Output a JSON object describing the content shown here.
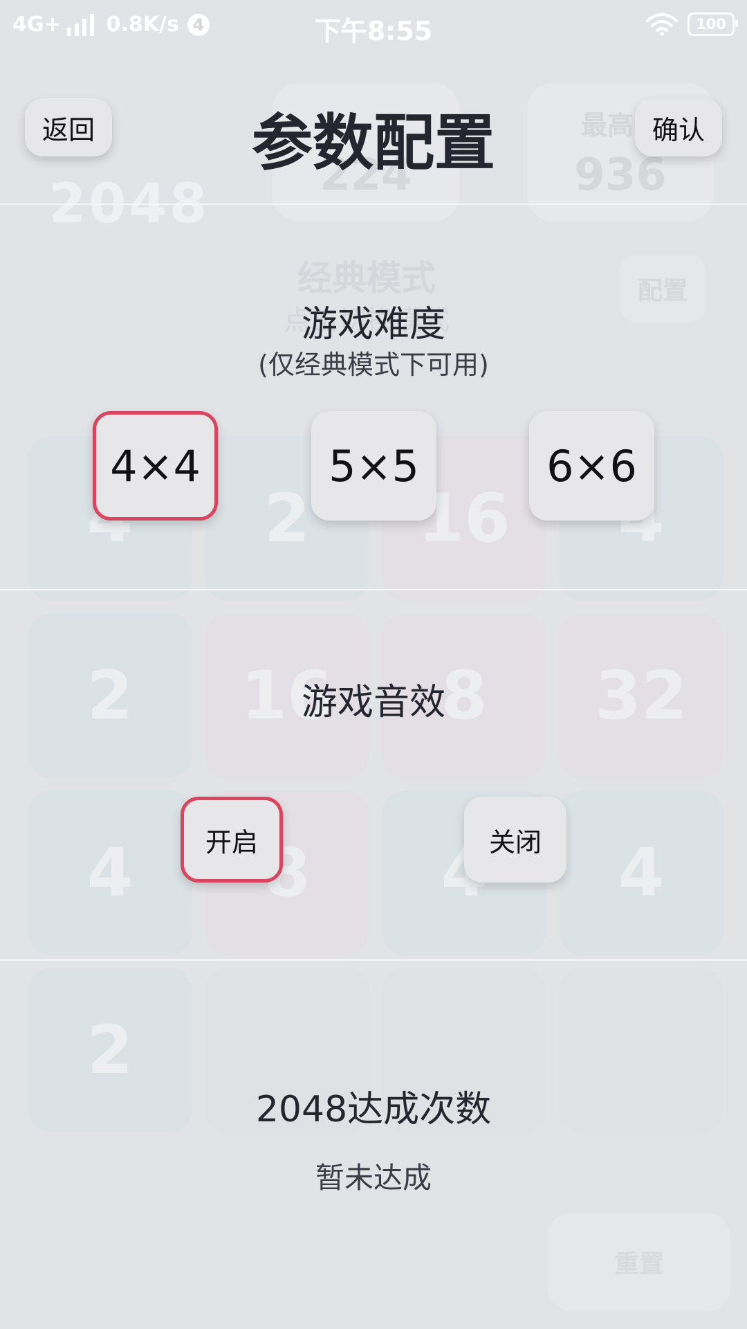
{
  "status_bar": {
    "network": "4G+",
    "speed": "0.8K/s",
    "notification_count": "4",
    "time": "下午8:55",
    "battery": "100"
  },
  "background": {
    "score_label": "",
    "score_value": "224",
    "best_label": "最高分",
    "best_value": "936",
    "logo_text": "2048",
    "mode_title": "经典模式",
    "mode_subtitle": "点击切换模式",
    "config_label": "配置",
    "reset_label": "重置",
    "tiles": [
      "4",
      "2",
      "16",
      "4",
      "2",
      "16",
      "8",
      "32",
      "4",
      "8",
      "4",
      "4",
      "2",
      "",
      "",
      ""
    ]
  },
  "header": {
    "back_label": "返回",
    "title": "参数配置",
    "confirm_label": "确认"
  },
  "difficulty": {
    "title": "游戏难度",
    "subtitle": "(仅经典模式下可用)",
    "options": [
      "4×4",
      "5×5",
      "6×6"
    ],
    "selected": "4×4"
  },
  "sound": {
    "title": "游戏音效",
    "on_label": "开启",
    "off_label": "关闭",
    "selected": "开启"
  },
  "achievement": {
    "title": "2048达成次数",
    "value": "暂未达成"
  },
  "colors": {
    "selected_border": "#d9455f",
    "background": "#e2e3e7",
    "button": "#e7e7e9"
  }
}
